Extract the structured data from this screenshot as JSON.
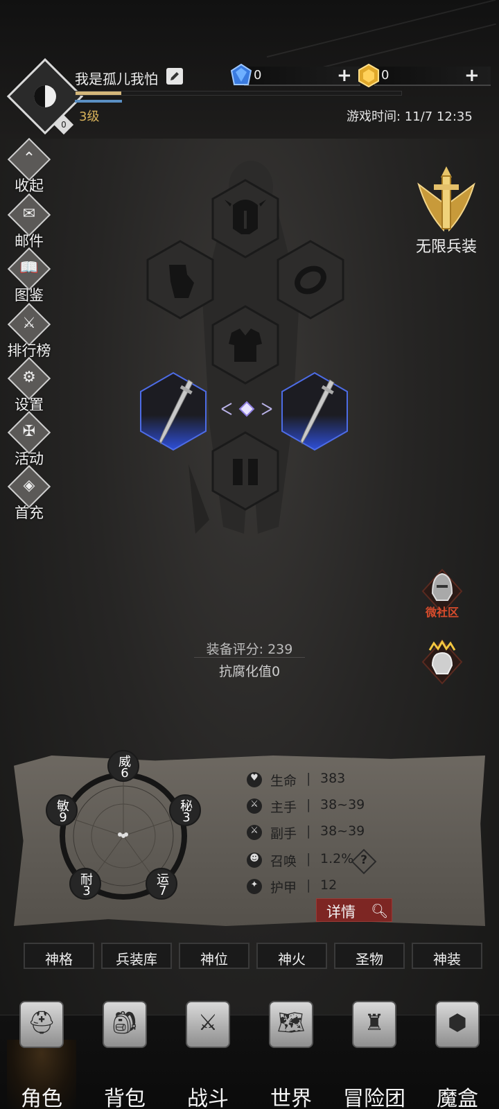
{
  "header": {
    "player_name": "我是孤儿我怕",
    "level": "3级",
    "avatar_badge": "0",
    "game_time": "游戏时间: 11/7 12:35",
    "exp_progress": 0.14,
    "currencies": [
      {
        "name": "blue-crystal",
        "value": "0"
      },
      {
        "name": "gold-crystal",
        "value": "0"
      }
    ]
  },
  "side_menu": [
    {
      "label": "收起",
      "icon": "collapse-icon"
    },
    {
      "label": "邮件",
      "icon": "mail-icon"
    },
    {
      "label": "图鉴",
      "icon": "book-icon"
    },
    {
      "label": "排行榜",
      "icon": "ranking-icon"
    },
    {
      "label": "设置",
      "icon": "gear-icon"
    },
    {
      "label": "活动",
      "icon": "event-icon"
    },
    {
      "label": "首充",
      "icon": "first-recharge-icon"
    }
  ],
  "right_menu": {
    "infinite_label": "无限兵装",
    "community_label": "微社区"
  },
  "equipment": {
    "score": "装备评分: 239",
    "corruption": "抗腐化值0"
  },
  "attributes": [
    {
      "name": "威",
      "value": "6"
    },
    {
      "name": "秘",
      "value": "3"
    },
    {
      "name": "运",
      "value": "7"
    },
    {
      "name": "耐",
      "value": "3"
    },
    {
      "name": "敏",
      "value": "9"
    }
  ],
  "stats": [
    {
      "label": "生命",
      "value": "383",
      "icon": "heart-icon"
    },
    {
      "label": "主手",
      "value": "38~39",
      "icon": "main-hand-icon"
    },
    {
      "label": "副手",
      "value": "38~39",
      "icon": "off-hand-icon"
    },
    {
      "label": "召唤",
      "value": "1.2%",
      "icon": "summon-icon"
    },
    {
      "label": "护甲",
      "value": "12",
      "icon": "armor-icon"
    }
  ],
  "stat_separator": "|",
  "detail_button": "详情",
  "sub_tabs": [
    "神格",
    "兵装库",
    "神位",
    "神火",
    "圣物",
    "神装"
  ],
  "bottom_nav": [
    {
      "label": "角色",
      "icon": "helmet-icon"
    },
    {
      "label": "背包",
      "icon": "backpack-icon"
    },
    {
      "label": "战斗",
      "icon": "sword-shield-icon"
    },
    {
      "label": "世界",
      "icon": "map-icon"
    },
    {
      "label": "冒险团",
      "icon": "castle-icon"
    },
    {
      "label": "魔盒",
      "icon": "cube-icon"
    }
  ],
  "colors": {
    "accent_gold": "#d8b25a",
    "exp_bar": "#d4b77a",
    "weapon_glow": "#2e4fd8",
    "detail_button": "#7d2623",
    "community_red": "#d84c2c"
  }
}
